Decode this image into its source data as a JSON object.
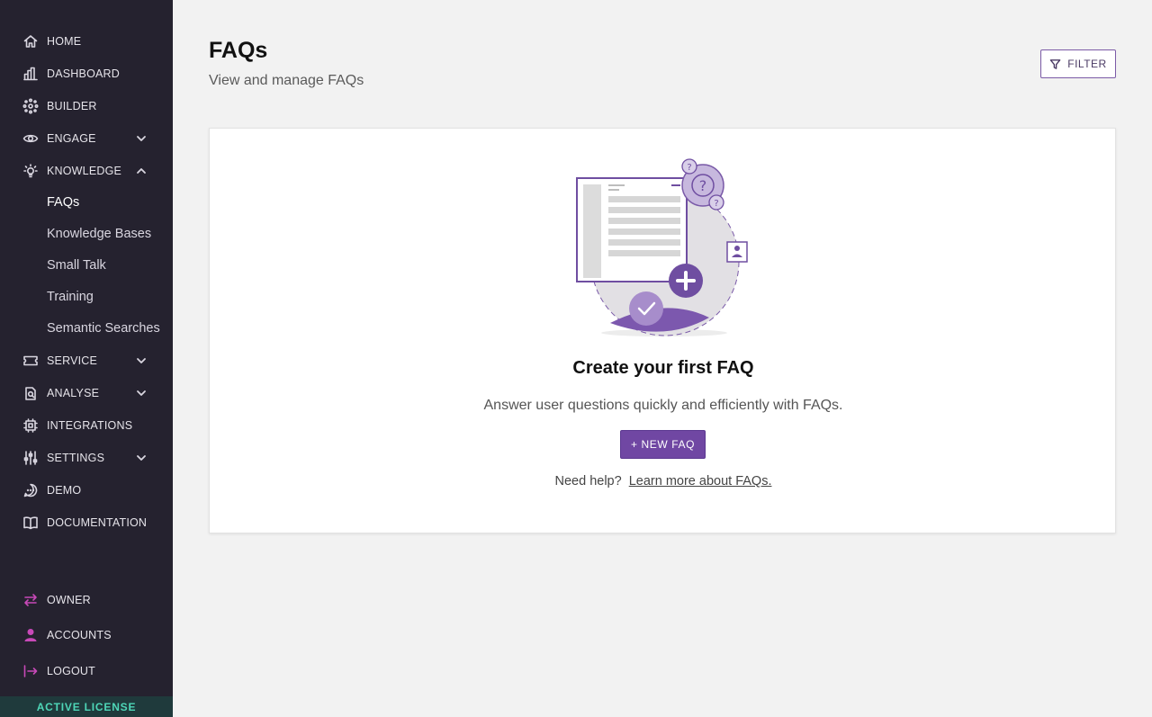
{
  "sidebar": {
    "items": [
      {
        "label": "HOME",
        "icon": "home-icon"
      },
      {
        "label": "DASHBOARD",
        "icon": "chart-bars-icon"
      },
      {
        "label": "BUILDER",
        "icon": "builder-nodes-icon"
      },
      {
        "label": "ENGAGE",
        "icon": "eye-icon"
      },
      {
        "label": "KNOWLEDGE",
        "icon": "lightbulb-icon"
      },
      {
        "label": "SERVICE",
        "icon": "ticket-icon"
      },
      {
        "label": "ANALYSE",
        "icon": "analyse-search-icon"
      },
      {
        "label": "INTEGRATIONS",
        "icon": "chip-icon"
      },
      {
        "label": "SETTINGS",
        "icon": "sliders-icon"
      },
      {
        "label": "DEMO",
        "icon": "chat-bubble-icon"
      },
      {
        "label": "DOCUMENTATION",
        "icon": "book-icon"
      }
    ],
    "knowledge_sub": [
      "FAQs",
      "Knowledge Bases",
      "Small Talk",
      "Training",
      "Semantic Searches"
    ],
    "bottom": [
      {
        "label": "OWNER",
        "icon": "swap-arrows-icon"
      },
      {
        "label": "ACCOUNTS",
        "icon": "user-icon"
      },
      {
        "label": "LOGOUT",
        "icon": "logout-icon"
      }
    ],
    "license": "ACTIVE LICENSE"
  },
  "header": {
    "title": "FAQs",
    "subtitle": "View and manage FAQs",
    "filter_label": "FILTER"
  },
  "empty_state": {
    "title": "Create your first FAQ",
    "description": "Answer user questions quickly and efficiently with FAQs.",
    "button_label": "+ NEW FAQ",
    "help_text": "Need help?",
    "help_link": "Learn more about FAQs."
  },
  "colors": {
    "sidebar_bg": "#25222f",
    "accent": "#7047a3",
    "bottom_icon": "#c849b8",
    "license_text": "#4ed6b7"
  }
}
